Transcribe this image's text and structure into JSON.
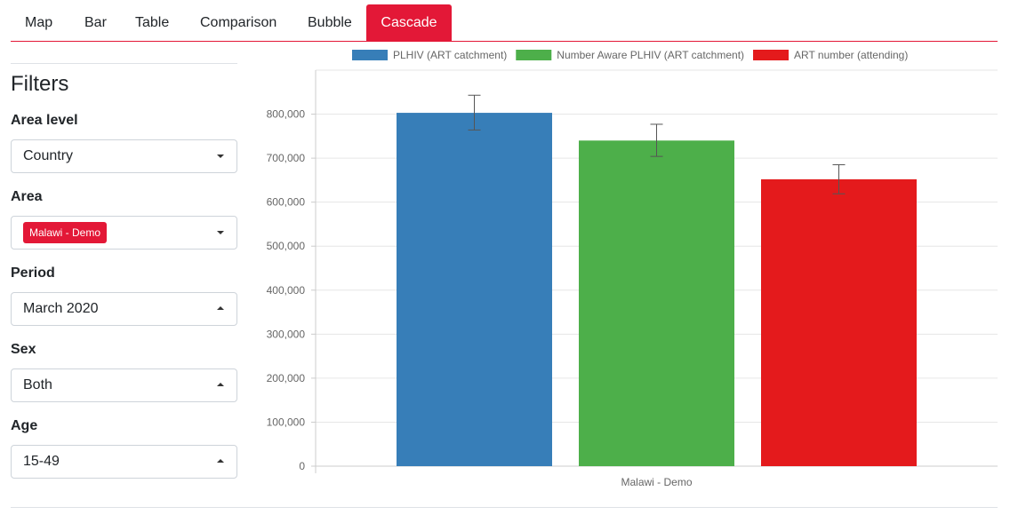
{
  "tabs": [
    {
      "label": "Map",
      "active": false
    },
    {
      "label": "Bar",
      "active": false
    },
    {
      "label": "Table",
      "active": false
    },
    {
      "label": "Comparison",
      "active": false
    },
    {
      "label": "Bubble",
      "active": false
    },
    {
      "label": "Cascade",
      "active": true
    }
  ],
  "filters": {
    "title": "Filters",
    "items": [
      {
        "label": "Area level",
        "value": "Country",
        "caret": "down"
      },
      {
        "label": "Area",
        "value": "Malawi - Demo",
        "caret": "down"
      },
      {
        "label": "Period",
        "value": "March 2020",
        "caret": "up"
      },
      {
        "label": "Sex",
        "value": "Both",
        "caret": "up"
      },
      {
        "label": "Age",
        "value": "15-49",
        "caret": "up"
      }
    ]
  },
  "colors": {
    "accent": "#e31837",
    "blue": "#377eb8",
    "green": "#4daf4a",
    "red": "#e41a1c"
  },
  "chart_data": {
    "type": "bar",
    "categories": [
      "Malawi - Demo"
    ],
    "series": [
      {
        "name": "PLHIV (ART catchment)",
        "color": "#377eb8",
        "values": [
          803000
        ],
        "error": [
          [
            764000,
            843000
          ]
        ]
      },
      {
        "name": "Number Aware PLHIV (ART catchment)",
        "color": "#4daf4a",
        "values": [
          740000
        ],
        "error": [
          [
            704000,
            777000
          ]
        ]
      },
      {
        "name": "ART number (attending)",
        "color": "#e41a1c",
        "values": [
          652000
        ],
        "error": [
          [
            619000,
            685000
          ]
        ]
      }
    ],
    "ylim": [
      0,
      900000
    ],
    "yticks": [
      0,
      100000,
      200000,
      300000,
      400000,
      500000,
      600000,
      700000,
      800000
    ],
    "ytick_labels": [
      "0",
      "100,000",
      "200,000",
      "300,000",
      "400,000",
      "500,000",
      "600,000",
      "700,000",
      "800,000"
    ],
    "grid": true,
    "legend": "top"
  }
}
